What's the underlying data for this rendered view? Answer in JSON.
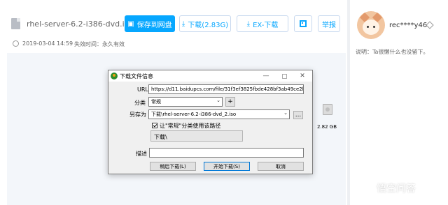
{
  "page": {
    "file_name": "rhel-server-6.2-i386-dvd.i...",
    "buttons": {
      "save_to_netdisk": "保存到网盘",
      "download": "下载(2.83G)",
      "ex_download": "EX-下载",
      "report": "举报"
    },
    "meta": {
      "date": "2019-03-04 14:59",
      "expiry_label": "失效时间：",
      "expiry_value": "永久有效"
    },
    "user": {
      "name": "rec****y46",
      "bio": "说明：Ta很懒什么也没留下。"
    }
  },
  "dialog": {
    "title": "下载文件信息",
    "url_label": "URL",
    "url_value": "https://d11.baidupcs.com/file/31f3ef3825fbde428bf3ab49ce2b99db?bkt=p",
    "category_label": "分类",
    "category_value": "常规",
    "add_category": "+",
    "save_as_label": "另存为",
    "save_as_value": "下载\\rhel-server-6.2-i386-dvd_2.iso",
    "browse": "...",
    "use_path_checkbox": "让\"常规\"分类使用该路径",
    "path_value": "下载\\",
    "file_size": "2.82  GB",
    "description_label": "描述",
    "description_value": "",
    "buttons": {
      "later": "稍后下载(L)",
      "start": "开始下载(S)",
      "cancel": "取消"
    },
    "window_controls": {
      "minimize": "—",
      "close": "✕"
    }
  },
  "watermark": {
    "text": "悟空问答"
  },
  "colors": {
    "primary": "#06a7ff",
    "dialog_bg": "#f0f0f0",
    "page_bg": "#f4f5f7"
  }
}
